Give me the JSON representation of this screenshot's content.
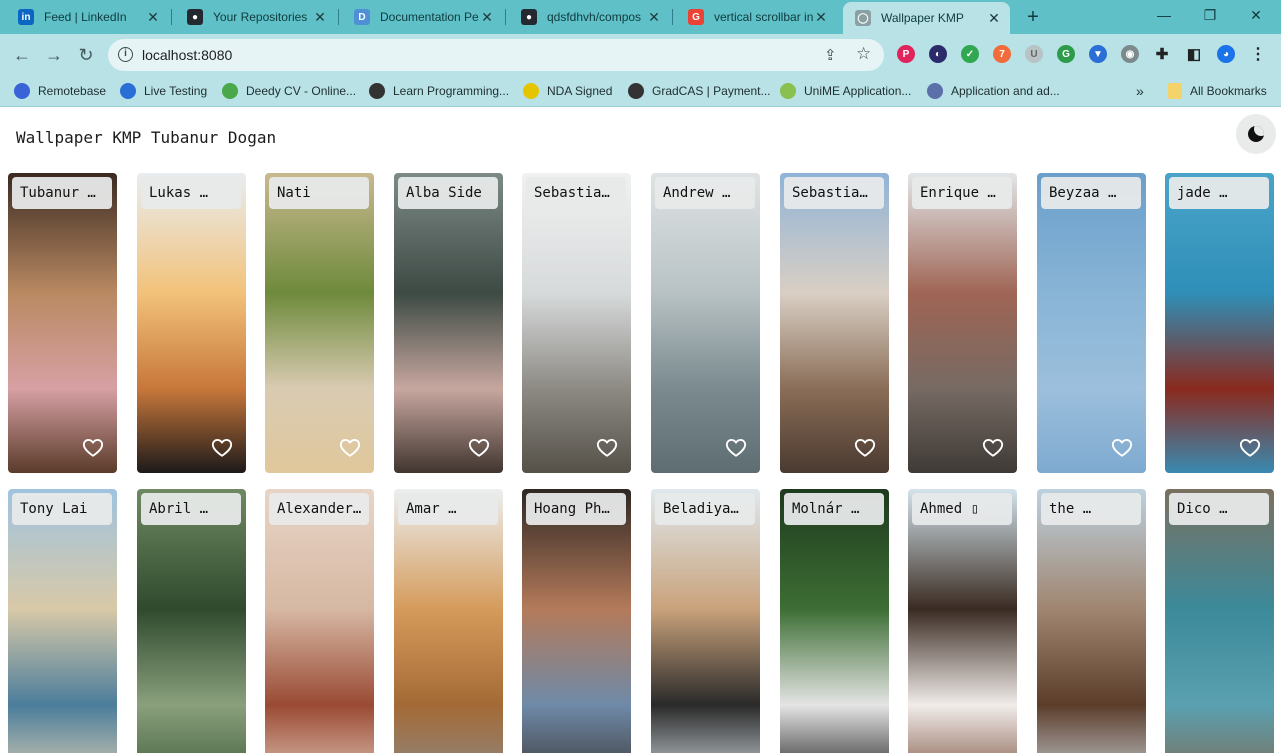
{
  "browser": {
    "tabs": [
      {
        "title": "Feed | LinkedIn",
        "fav": "linkedin-icon",
        "color": "#0a66c2",
        "glyph": "in"
      },
      {
        "title": "Your Repositories",
        "fav": "github-icon",
        "color": "#24292f",
        "glyph": "●"
      },
      {
        "title": "Documentation Pe",
        "fav": "doc-icon",
        "color": "#4f8fd6",
        "glyph": "D"
      },
      {
        "title": "qdsfdhvh/compos",
        "fav": "github-icon",
        "color": "#24292f",
        "glyph": "●"
      },
      {
        "title": "vertical scrollbar in",
        "fav": "google-icon",
        "color": "#ea4335",
        "glyph": "G"
      },
      {
        "title": "Wallpaper KMP",
        "fav": "globe-icon",
        "color": "#8aa0a3",
        "glyph": "◯"
      }
    ],
    "new_tab": "+",
    "window_controls": {
      "minimize": "—",
      "maximize": "❐",
      "close": "✕"
    },
    "address": "localhost:8080",
    "bookmarks": [
      {
        "label": "Remotebase",
        "color": "#3b63d8"
      },
      {
        "label": "Live Testing",
        "color": "#2a6fd6"
      },
      {
        "label": "Deedy CV - Online...",
        "color": "#4aa84a"
      },
      {
        "label": "Learn Programming...",
        "color": "#333333"
      },
      {
        "label": "NDA Signed",
        "color": "#e5c400"
      },
      {
        "label": "GradCAS | Payment...",
        "color": "#333333"
      },
      {
        "label": "UniME Application...",
        "color": "#8ac04f"
      },
      {
        "label": "Application and ad...",
        "color": "#5b6fa8"
      }
    ],
    "bookmarks_more": "»",
    "all_bookmarks": "All Bookmarks"
  },
  "app": {
    "title": "Wallpaper KMP Tubanur Dogan"
  },
  "wallpapers": [
    {
      "author": "Tubanur …",
      "colors": [
        "#3b2a22",
        "#b98a62",
        "#d7a0a4",
        "#5a3b2a"
      ]
    },
    {
      "author": "Lukas …",
      "colors": [
        "#e8edf0",
        "#f2c27a",
        "#c7773a",
        "#1d1a1a"
      ]
    },
    {
      "author": "Nati",
      "colors": [
        "#c9b98f",
        "#6e8a3b",
        "#d9cbb2",
        "#e0c79b"
      ]
    },
    {
      "author": "Alba  Side",
      "colors": [
        "#7d8a86",
        "#3d4a44",
        "#c7a7a0",
        "#41352f"
      ]
    },
    {
      "author": "Sebastia…",
      "colors": [
        "#f0f1f1",
        "#d7dadb",
        "#8d8a84",
        "#555149"
      ]
    },
    {
      "author": "Andrew …",
      "colors": [
        "#dfe3e4",
        "#b8c2c4",
        "#7a8a8e",
        "#5e6d71"
      ]
    },
    {
      "author": "Sebastia…",
      "colors": [
        "#8fb3d7",
        "#d9cfc4",
        "#8a6d57",
        "#4a3a30"
      ]
    },
    {
      "author": "Enrique …",
      "colors": [
        "#e2e6e8",
        "#9f6555",
        "#766a63",
        "#3f3a36"
      ]
    },
    {
      "author": "Beyzaa …",
      "colors": [
        "#6a9fcb",
        "#88b4d6",
        "#9cbfdc",
        "#7eaad0"
      ]
    },
    {
      "author": "jade …",
      "colors": [
        "#4aa4c9",
        "#2f8fb8",
        "#8a2a1e",
        "#3a8ab1"
      ]
    },
    {
      "author": "Tony Lai",
      "colors": [
        "#9fc3e0",
        "#d8c9a8",
        "#4b7d9b",
        "#e2d3b5"
      ]
    },
    {
      "author": "Abril …",
      "colors": [
        "#6f8a62",
        "#2f4a2d",
        "#8aa07d",
        "#3e5a38"
      ]
    },
    {
      "author": "Alexander…",
      "colors": [
        "#e8d5c6",
        "#d6b8a3",
        "#9a4a34",
        "#e3cbbb"
      ]
    },
    {
      "author": "Amar   …",
      "colors": [
        "#eceff0",
        "#d59b5b",
        "#a46a36",
        "#8a8a87"
      ]
    },
    {
      "author": "Hoang Ph…",
      "colors": [
        "#2e2724",
        "#b47a5a",
        "#6f8aa8",
        "#3a3634"
      ]
    },
    {
      "author": "Beladiya…",
      "colors": [
        "#dfe9ee",
        "#c9a27b",
        "#2a2a2a",
        "#d8e2e7"
      ]
    },
    {
      "author": "Molnár …",
      "colors": [
        "#1e3a1e",
        "#3d6e34",
        "#e4e4e4",
        "#141414"
      ]
    },
    {
      "author": "Ahmed  ▯",
      "colors": [
        "#d4e4ec",
        "#3a2b22",
        "#f1ecea",
        "#7a4e3a"
      ]
    },
    {
      "author": "the …",
      "colors": [
        "#bcd1df",
        "#a08570",
        "#5b3d2a",
        "#ccd6dd"
      ]
    },
    {
      "author": "Dico …",
      "colors": [
        "#7a7060",
        "#3c8a9a",
        "#5aa0b0",
        "#806a54"
      ]
    }
  ],
  "favorite_icon": "heart-outline-icon",
  "theme_toggle_icon": "moon-icon"
}
